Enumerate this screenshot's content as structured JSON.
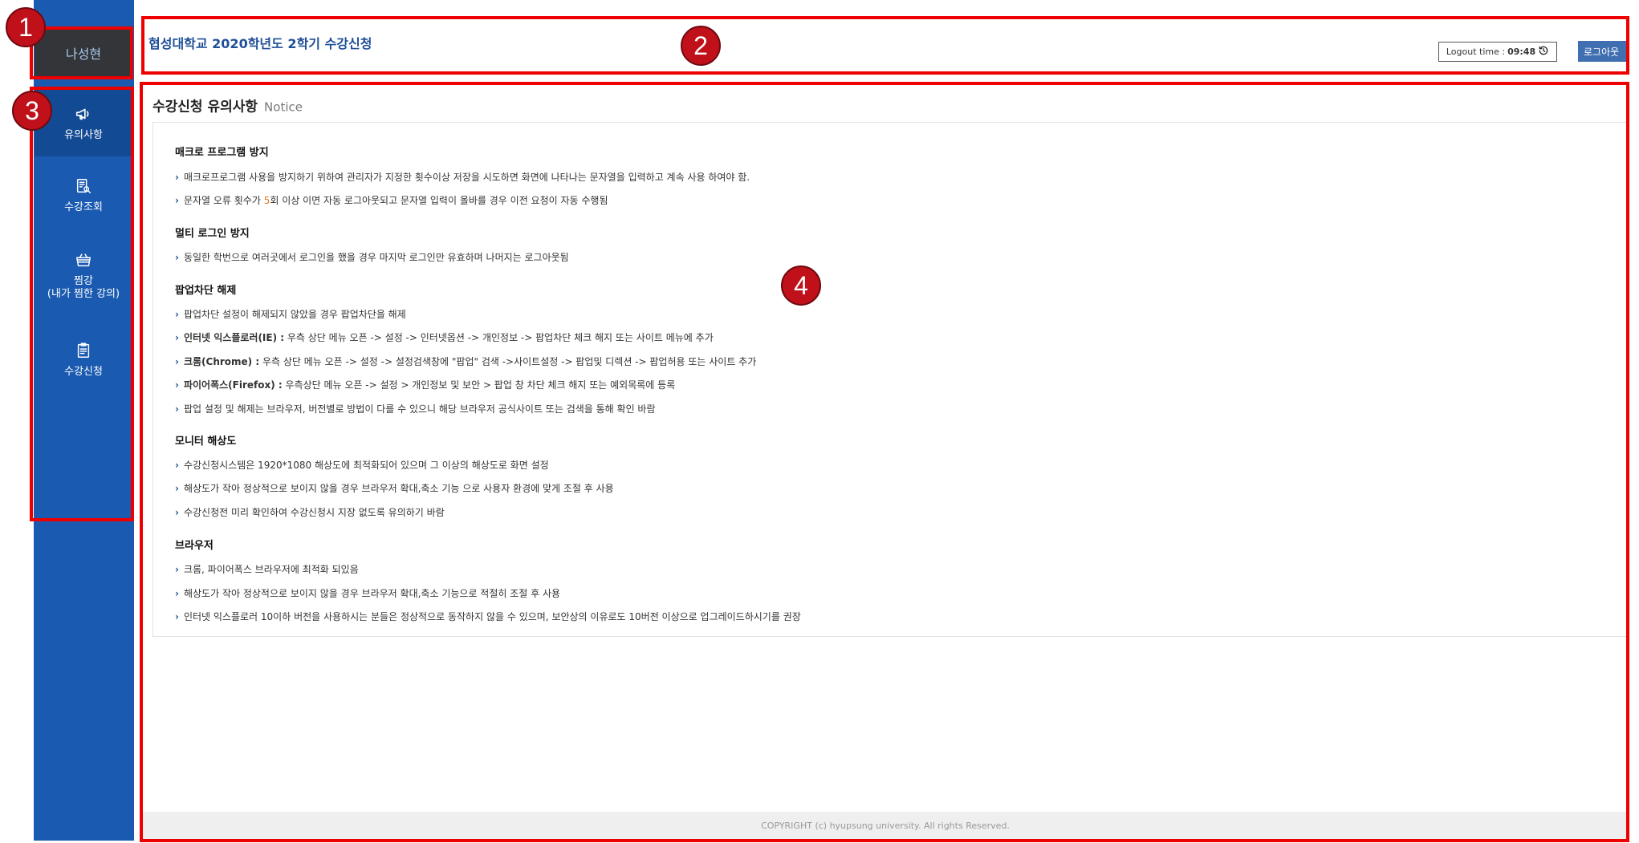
{
  "user": {
    "name": "나성현"
  },
  "header": {
    "title": "협성대학교 2020학년도 2학기 수강신청",
    "logout_time_label": "Logout time : ",
    "logout_time_value": "09:48",
    "logout_button": "로그아웃"
  },
  "nav": {
    "items": [
      {
        "label": "유의사항",
        "icon": "megaphone-icon"
      },
      {
        "label": "수강조회",
        "icon": "search-document-icon"
      },
      {
        "label": "찜강",
        "label2": "(내가 찜한 강의)",
        "icon": "basket-icon"
      },
      {
        "label": "수강신청",
        "icon": "clipboard-icon"
      }
    ]
  },
  "main": {
    "title": "수강신청 유의사항",
    "subtitle": "Notice",
    "sections": [
      {
        "title": "매크로 프로그램 방지",
        "items": [
          "매크로프로그램 사용을 방지하기 위하여 관리자가 지정한 횟수이상 저장을 시도하면 화면에 나타나는 문자열을 입력하고 계속 사용 하여야 함.",
          {
            "pre": "문자열 오류 횟수가 ",
            "hl": "5",
            "post": "회 이상 이면 자동 로그아웃되고 문자열 입력이 올바를 경우 이전 요청이 자동 수행됨"
          }
        ]
      },
      {
        "title": "멀티 로그인 방지",
        "items": [
          "동일한 학번으로 여러곳에서 로그인을 했을 경우 마지막 로그인만 유효하며 나머지는 로그아웃됨"
        ]
      },
      {
        "title": "팝업차단 해제",
        "items": [
          "팝업차단 설정이 해제되지 않았을 경우 팝업차단을 해제",
          {
            "bold": "인터넷 익스플로러(IE) :",
            "post": " 우측 상단 메뉴 오픈 -> 설정 -> 인터넷옵션 -> 개인정보 -> 팝업차단 체크 해지 또는 사이트 메뉴에 추가"
          },
          {
            "bold": "크롬(Chrome) :",
            "post": " 우측 상단 메뉴 오픈 -> 설정 -> 설정검색창에 \"팝업\" 검색 ->사이트설정 -> 팝업및 디렉션 -> 팝업허용 또는 사이트 추가"
          },
          {
            "bold": "파이어폭스(Firefox) :",
            "post": " 우측상단 메뉴 오픈 -> 설정 > 개인정보 및 보안 > 팝업 창 차단 체크 해지 또는 예외목록에 등록"
          },
          "팝업 설정 및 해제는 브라우저, 버전별로 방법이 다를 수 있으니 해당 브라우저 공식사이트 또는 검색을 통해 확인 바람"
        ]
      },
      {
        "title": "모니터 해상도",
        "items": [
          "수강신청시스템은 1920*1080 해상도에 최적화되어 있으며 그 이상의 해상도로 화면 설정",
          "해상도가 작아 정상적으로 보이지 않을 경우 브라우저 확대,축소 기능 으로 사용자 환경에 맞게 조절 후 사용",
          "수강신청전 미리 확인하여 수강신청시 지장 없도록 유의하기 바람"
        ]
      },
      {
        "title": "브라우저",
        "items": [
          "크롬, 파이어폭스 브라우저에 최적화 되있음",
          "해상도가 작아 정상적으로 보이지 않을 경우 브라우저 확대,축소 기능으로 적절히 조절 후 사용",
          "인터넷 익스플로러 10이하 버전을 사용하시는 분들은 정상적으로 동작하지 않을 수 있으며, 보안상의 이유로도 10버전 이상으로 업그레이드하시기를 권장"
        ]
      }
    ]
  },
  "footer": {
    "text": "COPYRIGHT (c) hyupsung university. All rights Reserved."
  },
  "annotations": [
    "1",
    "2",
    "3",
    "4"
  ],
  "colors": {
    "sidebar": "#1a5ab0",
    "accent": "#1f4f98",
    "highlight": "#e8781d",
    "annotation": "#e00000"
  }
}
